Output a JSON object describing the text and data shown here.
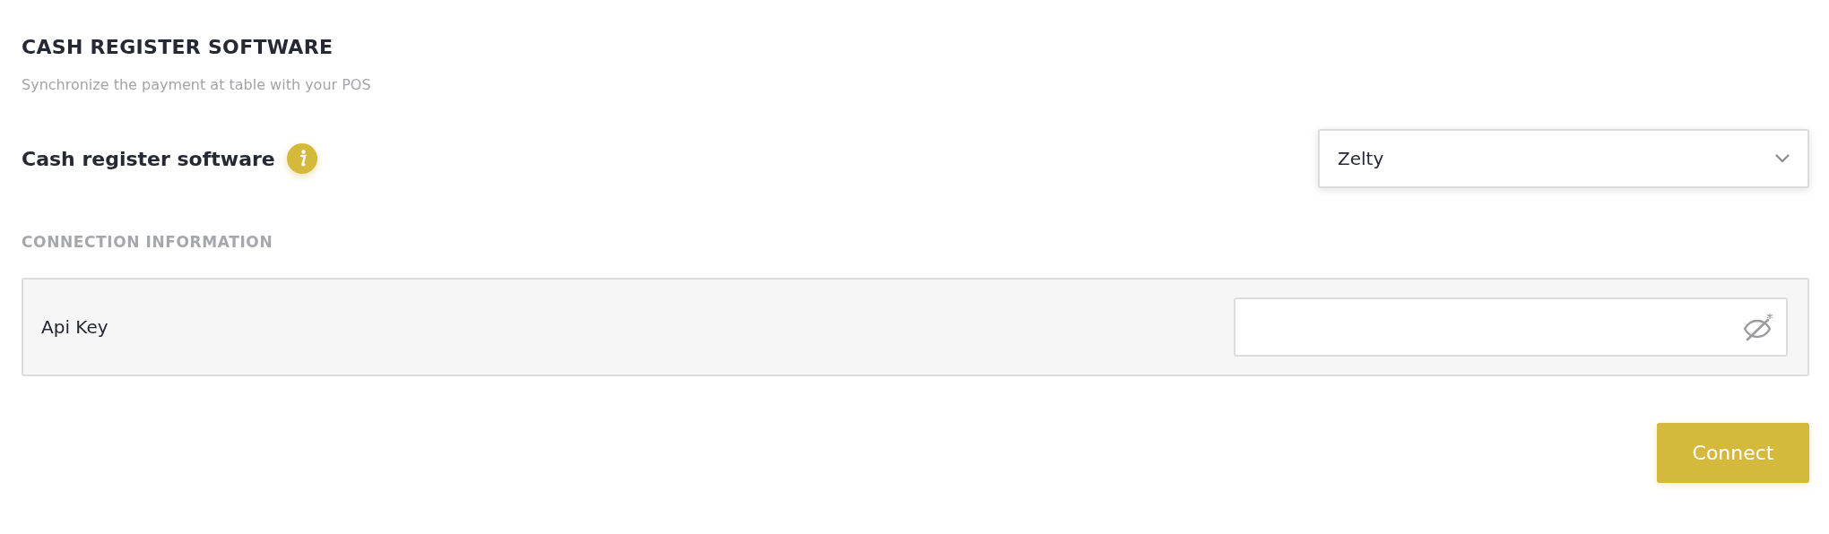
{
  "section": {
    "title": "CASH REGISTER SOFTWARE",
    "subtitle": "Synchronize the payment at table with your POS"
  },
  "software": {
    "label": "Cash register software",
    "value": "Zelty"
  },
  "connection": {
    "heading": "CONNECTION INFORMATION",
    "fields": [
      {
        "label": "Api Key",
        "kind": "secret"
      }
    ]
  },
  "buttons": [
    {
      "label": "Connect"
    }
  ]
}
